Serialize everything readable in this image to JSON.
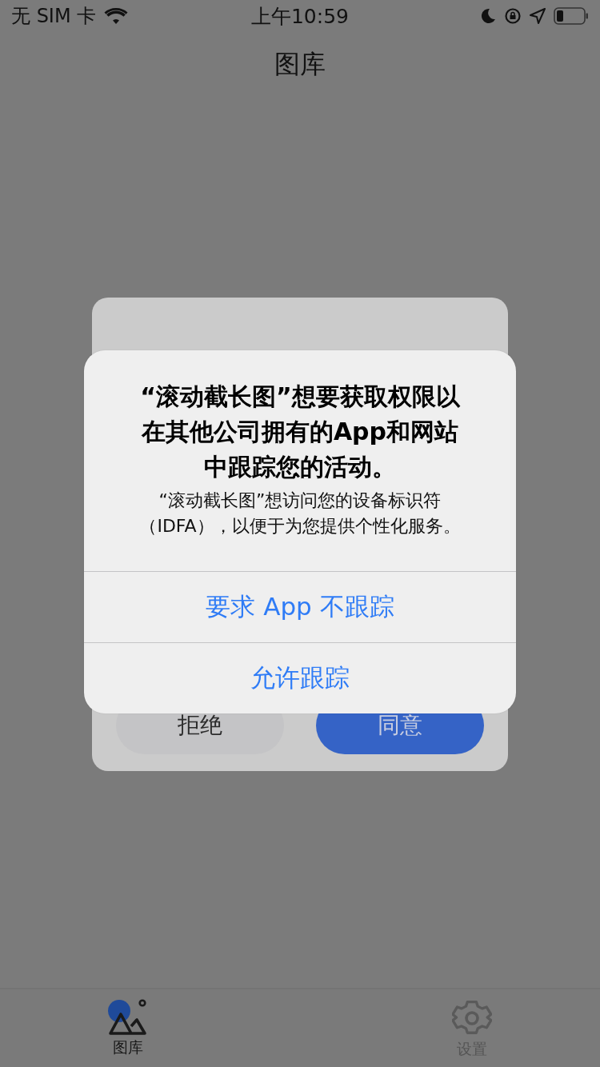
{
  "status_bar": {
    "carrier": "无 SIM 卡",
    "time": "上午10:59"
  },
  "nav_bar": {
    "title": "图库"
  },
  "agreement_dialog": {
    "buttons": [
      {
        "label": "拒绝",
        "kind": "secondary"
      },
      {
        "label": "同意",
        "kind": "primary"
      }
    ]
  },
  "tracking_alert": {
    "title": "“滚动截长图”想要获取权限以在其他公司拥有的App和网站中跟踪您的活动。",
    "message": "“滚动截长图”想访问您的设备标识符（IDFA），以便于为您提供个性化服务。",
    "buttons": [
      {
        "label": "要求 App 不跟踪"
      },
      {
        "label": "允许跟踪"
      }
    ]
  },
  "tab_bar": {
    "tabs": [
      {
        "label": "图库",
        "kind": "gallery",
        "selected": true
      },
      {
        "label": "设置",
        "kind": "settings",
        "selected": false
      }
    ]
  }
}
